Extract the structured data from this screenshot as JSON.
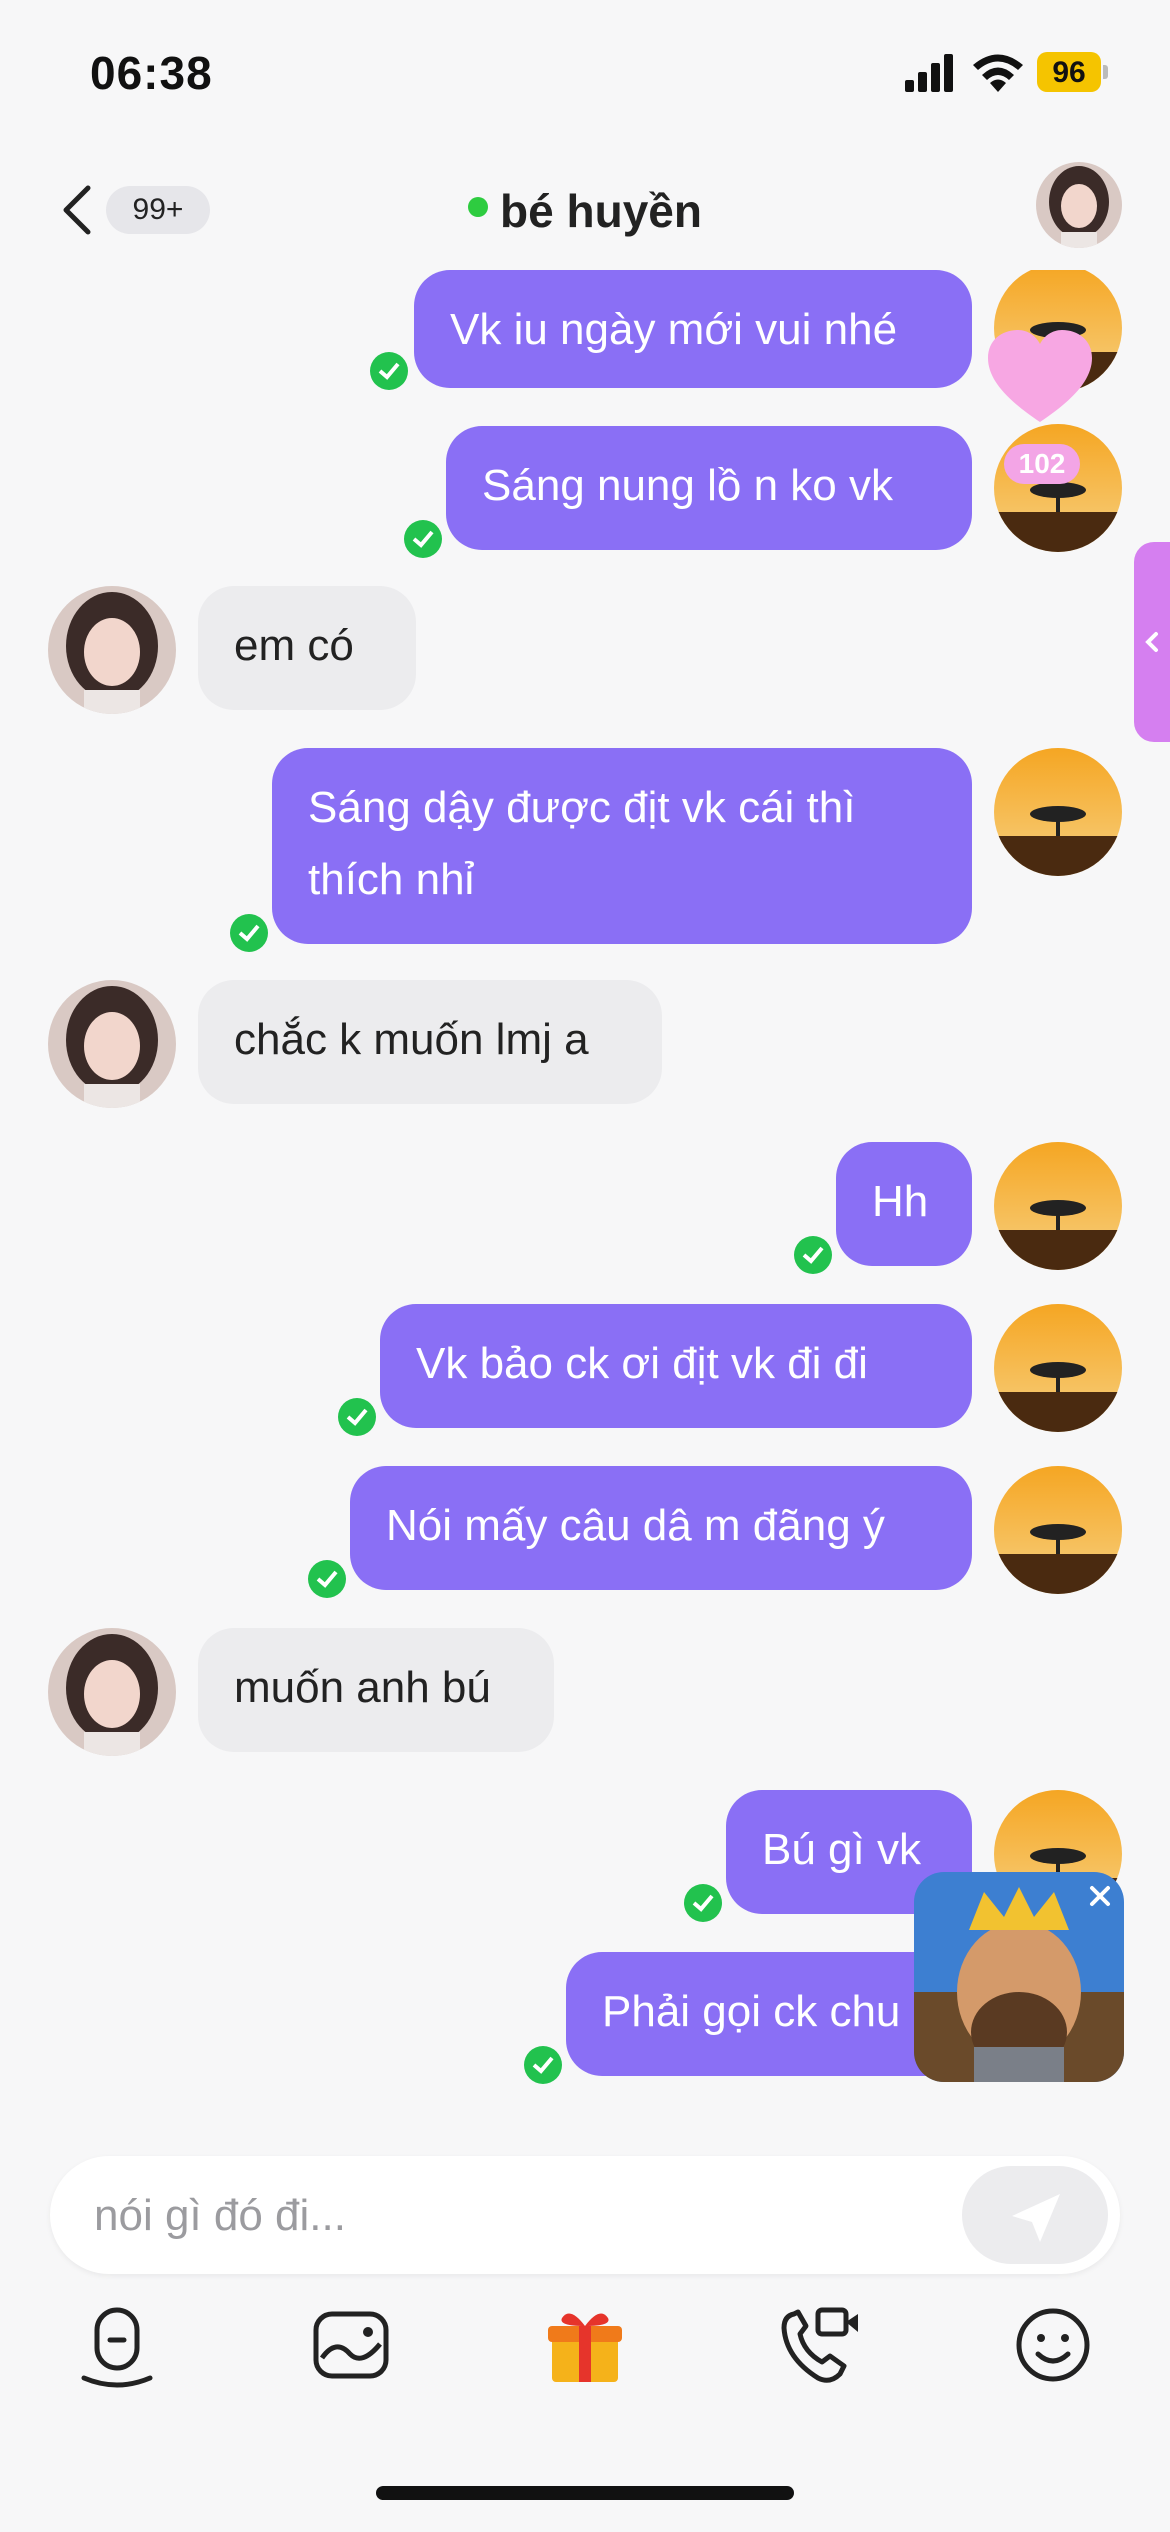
{
  "status": {
    "time": "06:38",
    "battery": "96"
  },
  "header": {
    "back_count": "99+",
    "title": "bé huyền",
    "online": true
  },
  "messages": [
    {
      "side": "out",
      "text": "Vk iu ngày mới vui nhé"
    },
    {
      "side": "out",
      "text": "Sáng nung lồ n ko vk"
    },
    {
      "side": "in",
      "text": "em có"
    },
    {
      "side": "out",
      "text": "Sáng dậy được địt vk cái thì thích nhỉ",
      "line1": "Sáng dậy được địt vk cái thì",
      "line2": "thích nhỉ"
    },
    {
      "side": "in",
      "text": "chắc k muốn lmj a"
    },
    {
      "side": "out",
      "text": "Hh"
    },
    {
      "side": "out",
      "text": "Vk bảo ck ơi địt vk đi đi"
    },
    {
      "side": "out",
      "text": "Nói mấy câu dâ m đãng ý"
    },
    {
      "side": "in",
      "text": "muốn anh bú"
    },
    {
      "side": "out",
      "text": "Bú gì vk"
    },
    {
      "side": "out",
      "text": "Phải gọi ck chu"
    }
  ],
  "floating": {
    "heart_count": "102"
  },
  "composer": {
    "placeholder": "nói gì đó đi..."
  },
  "toolbar": {
    "icons": [
      "voice-icon",
      "image-icon",
      "gift-icon",
      "video-call-icon",
      "emoji-icon"
    ]
  },
  "colors": {
    "accent": "#8a6ff5",
    "online": "#2ecc40",
    "sent_check": "#22c24e",
    "incoming_bubble": "#ececee"
  }
}
